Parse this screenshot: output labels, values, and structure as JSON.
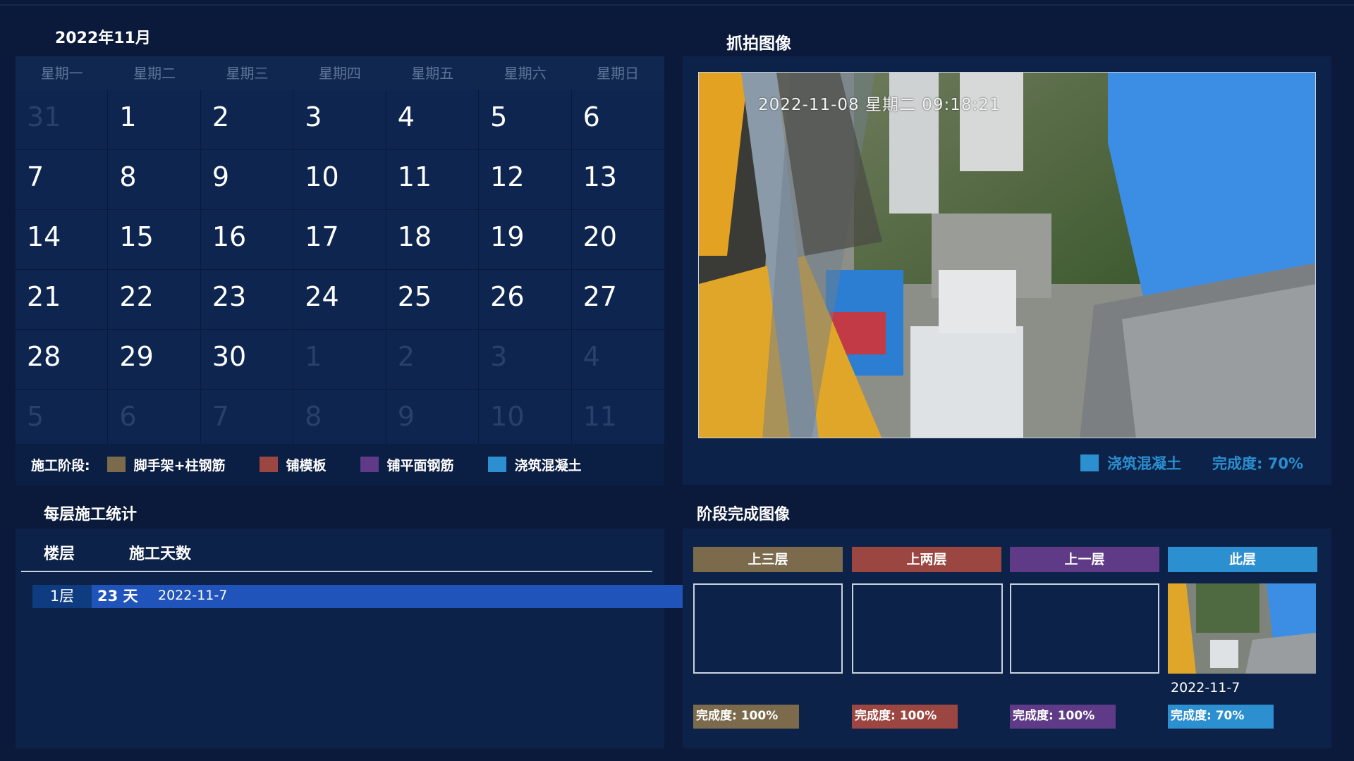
{
  "calendar": {
    "month_label": "2022年11月",
    "weekdays": [
      "星期一",
      "星期二",
      "星期三",
      "星期四",
      "星期五",
      "星期六",
      "星期日"
    ],
    "weeks": [
      [
        {
          "d": "31",
          "other": true
        },
        {
          "d": "1"
        },
        {
          "d": "2"
        },
        {
          "d": "3"
        },
        {
          "d": "4"
        },
        {
          "d": "5"
        },
        {
          "d": "6"
        }
      ],
      [
        {
          "d": "7"
        },
        {
          "d": "8"
        },
        {
          "d": "9"
        },
        {
          "d": "10"
        },
        {
          "d": "11"
        },
        {
          "d": "12"
        },
        {
          "d": "13"
        }
      ],
      [
        {
          "d": "14"
        },
        {
          "d": "15"
        },
        {
          "d": "16"
        },
        {
          "d": "17"
        },
        {
          "d": "18"
        },
        {
          "d": "19"
        },
        {
          "d": "20"
        }
      ],
      [
        {
          "d": "21"
        },
        {
          "d": "22"
        },
        {
          "d": "23"
        },
        {
          "d": "24"
        },
        {
          "d": "25"
        },
        {
          "d": "26"
        },
        {
          "d": "27"
        }
      ],
      [
        {
          "d": "28"
        },
        {
          "d": "29"
        },
        {
          "d": "30"
        },
        {
          "d": "1",
          "other": true
        },
        {
          "d": "2",
          "other": true
        },
        {
          "d": "3",
          "other": true
        },
        {
          "d": "4",
          "other": true
        }
      ],
      [
        {
          "d": "5",
          "other": true
        },
        {
          "d": "6",
          "other": true
        },
        {
          "d": "7",
          "other": true
        },
        {
          "d": "8",
          "other": true
        },
        {
          "d": "9",
          "other": true
        },
        {
          "d": "10",
          "other": true
        },
        {
          "d": "11",
          "other": true
        }
      ]
    ],
    "legend_title": "施工阶段:",
    "legend": [
      {
        "label": "脚手架+柱钢筋",
        "color": "#7b6a4b"
      },
      {
        "label": "铺模板",
        "color": "#9c4641"
      },
      {
        "label": "铺平面钢筋",
        "color": "#5f3a86"
      },
      {
        "label": "浇筑混凝土",
        "color": "#2b8fd0"
      }
    ]
  },
  "snapshot": {
    "title": "抓拍图像",
    "stamp": "2022-11-08 星期二 09:18:21",
    "stage_label": "浇筑混凝土",
    "stage_color": "#2b8fd0",
    "progress_text": "完成度: 70%"
  },
  "floor_stats": {
    "title": "每层施工统计",
    "col_floor": "楼层",
    "col_days": "施工天数",
    "rows": [
      {
        "floor": "1层",
        "days": "23 天",
        "date": "2022-11-7"
      }
    ]
  },
  "stage_images": {
    "title": "阶段完成图像",
    "columns": [
      {
        "label": "上三层",
        "color": "#7b6a4b",
        "progress": "完成度: 100%",
        "date": "",
        "has_image": false
      },
      {
        "label": "上两层",
        "color": "#9c4641",
        "progress": "完成度: 100%",
        "date": "",
        "has_image": false
      },
      {
        "label": "上一层",
        "color": "#5f3a86",
        "progress": "完成度: 100%",
        "date": "",
        "has_image": false
      },
      {
        "label": "此层",
        "color": "#2b8fd0",
        "progress": "完成度: 70%",
        "date": "2022-11-7",
        "has_image": true
      }
    ]
  }
}
